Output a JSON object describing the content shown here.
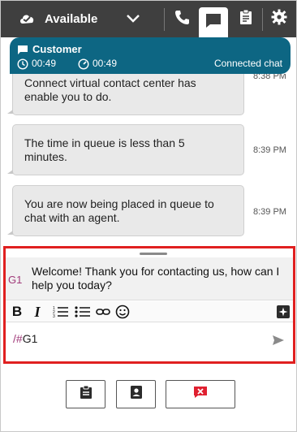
{
  "agent_status": {
    "label": "Available"
  },
  "contact": {
    "name": "Customer",
    "timer_contact": "00:49",
    "timer_wait": "00:49",
    "state": "Connected chat"
  },
  "transcript": [
    {
      "text_line1": "Connect virtual contact center has",
      "text_line2": "enable you to do.",
      "time": "8:38 PM"
    },
    {
      "text_line1": "The time in queue is less than 5",
      "text_line2": "minutes.",
      "time": "8:39 PM"
    },
    {
      "text_line1": "You are now being placed in queue to",
      "text_line2": "chat with an agent.",
      "time": "8:39 PM"
    }
  ],
  "quick_response": {
    "code": "G1",
    "message": "Welcome! Thank you for contacting us, how can I help you today?"
  },
  "editor": {
    "tools": [
      "bold-icon",
      "italic-icon",
      "numbered-list-icon",
      "bulleted-list-icon",
      "link-icon",
      "emoji-icon",
      "quick-response-icon"
    ],
    "bold_label": "B",
    "italic_label": "I",
    "input_prefix": "/#",
    "input_value": "G1"
  },
  "actions": [
    "task-icon",
    "contact-card-icon",
    "end-chat-icon"
  ],
  "colors": {
    "topbar": "#3f3f3f",
    "contact_header": "#0d6683",
    "highlight": "#e02020",
    "end_chat": "#e02030"
  }
}
